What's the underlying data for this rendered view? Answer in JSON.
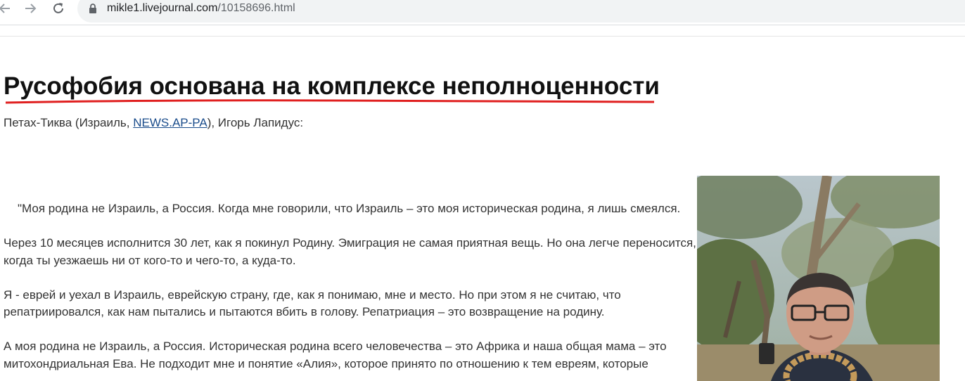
{
  "browser": {
    "url_domain": "mikle1.livejournal.com",
    "url_path": "/10158696.html",
    "icons": [
      "back-arrow-icon",
      "forward-arrow-icon",
      "reload-icon",
      "lock-icon"
    ]
  },
  "article": {
    "title": "Русофобия основана на комплексе неполноценности",
    "title_underline_color": "#e02020",
    "byline": {
      "prefix": "Петах-Тиква (Израиль, ",
      "source_link": "NEWS.AP-PA",
      "suffix": "), Игорь Лапидус:"
    },
    "paragraphs": [
      "\"Моя родина не Израиль, а Россия. Когда мне говорили, что Израиль – это моя историческая родина, я лишь смеялся.",
      "Через 10 месяцев исполнится 30 лет, как я покинул Родину. Эмиграция не самая приятная вещь. Но она легче переносится, когда ты уезжаешь ни от кого-то и чего-то, а куда-то.",
      "Я - еврей и уехал в Израиль, еврейскую страну, где, как я понимаю, мне и место. Но при этом я не считаю, что репатриировался, как нам пытались и пытаются вбить в голову. Репатриация – это возвращение на родину.",
      "А моя родина не Израиль, а Россия. Историческая родина всего человечества – это Африка и наша общая мама – это митохондриальная Ева. Не подходит мне и понятие «Алия», которое принято по отношению к тем евреям, которые"
    ]
  },
  "colors": {
    "link": "#1a4c8b",
    "text": "#333333",
    "omnibox_bg": "#f1f3f4"
  }
}
